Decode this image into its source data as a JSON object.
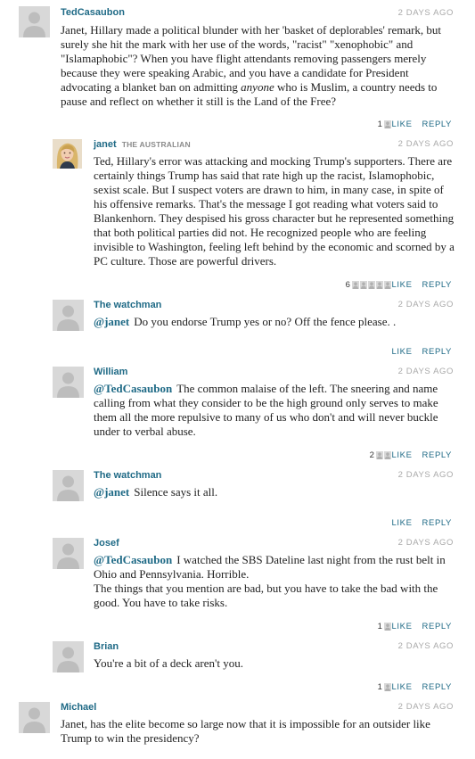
{
  "comments": [
    {
      "author": "TedCasaubon",
      "affiliation": "",
      "time": "2 DAYS AGO",
      "avatar": "default",
      "mention": "",
      "body_pre": "Janet, Hillary made a political blunder with her 'basket of deplorables' remark, but surely she hit the mark with her use of the words, \"racist\" \"xenophobic\" and \"Islamaphobic\"? When you have flight attendants removing passengers merely because they were speaking Arabic, and you have a candidate for President advocating a blanket ban on admitting",
      "body_em": "anyone",
      "body_post": "who is Muslim, a country needs to pause and reflect on whether it still is the Land of the Free?",
      "like_count": "1",
      "like_label": "LIKE",
      "reply_label": "REPLY"
    },
    {
      "author": "janet",
      "affiliation": "THE AUSTRALIAN",
      "time": "2 DAYS AGO",
      "avatar": "photo",
      "mention": "",
      "body": "Ted, Hillary's error was attacking and mocking Trump's supporters. There are certainly things Trump has said that rate high up the racist, Islamophobic, sexist scale. But I suspect voters are drawn to him, in many case, in spite of his offensive remarks. That's the message I got reading what voters said to Blankenhorn. They despised his gross character but he represented something that both political parties did not. He recognized people who are feeling invisible to Washington, feeling left behind by the economic and scorned by a PC culture. Those are powerful drivers.",
      "like_count": "6",
      "like_label": "LIKE",
      "reply_label": "REPLY"
    },
    {
      "author": "The watchman",
      "affiliation": "",
      "time": "2 DAYS AGO",
      "avatar": "default",
      "mention": "@janet",
      "body": "Do you endorse Trump yes or no? Off the fence please. .",
      "like_count": "",
      "like_label": "LIKE",
      "reply_label": "REPLY"
    },
    {
      "author": "William",
      "affiliation": "",
      "time": "2 DAYS AGO",
      "avatar": "default",
      "mention": "@TedCasaubon",
      "body": "The common malaise of the left. The sneering and name calling from what they consider to be the high ground only serves to make them all the more repulsive to many of us who don't and will never buckle under to verbal abuse.",
      "like_count": "2",
      "like_label": "LIKE",
      "reply_label": "REPLY"
    },
    {
      "author": "The watchman",
      "affiliation": "",
      "time": "2 DAYS AGO",
      "avatar": "default",
      "mention": "@janet",
      "body": "Silence says it all.",
      "like_count": "",
      "like_label": "LIKE",
      "reply_label": "REPLY"
    },
    {
      "author": "Josef",
      "affiliation": "",
      "time": "2 DAYS AGO",
      "avatar": "default",
      "mention": "@TedCasaubon",
      "body": "I watched the SBS Dateline last night from the rust belt in Ohio and Pennsylvania. Horrible.",
      "body2": "The things that you mention are bad, but you have to take the bad with the good. You have to take risks.",
      "like_count": "1",
      "like_label": "LIKE",
      "reply_label": "REPLY"
    },
    {
      "author": "Brian",
      "affiliation": "",
      "time": "2 DAYS AGO",
      "avatar": "default",
      "mention": "",
      "body": "You're a bit of a deck aren't you.",
      "like_count": "1",
      "like_label": "LIKE",
      "reply_label": "REPLY"
    },
    {
      "author": "Michael",
      "affiliation": "",
      "time": "2 DAYS AGO",
      "avatar": "default",
      "mention": "",
      "body": "Janet, has the elite become so large now that it is impossible for an outsider like Trump to win the presidency?",
      "like_count": "",
      "like_label": "",
      "reply_label": ""
    }
  ],
  "colors": {
    "author": "#1f6a86",
    "link": "#1f6a86",
    "timestamp": "#a9a9a9",
    "avatar_bg": "#d8d8d8",
    "affiliation": "#8a8a8a"
  }
}
